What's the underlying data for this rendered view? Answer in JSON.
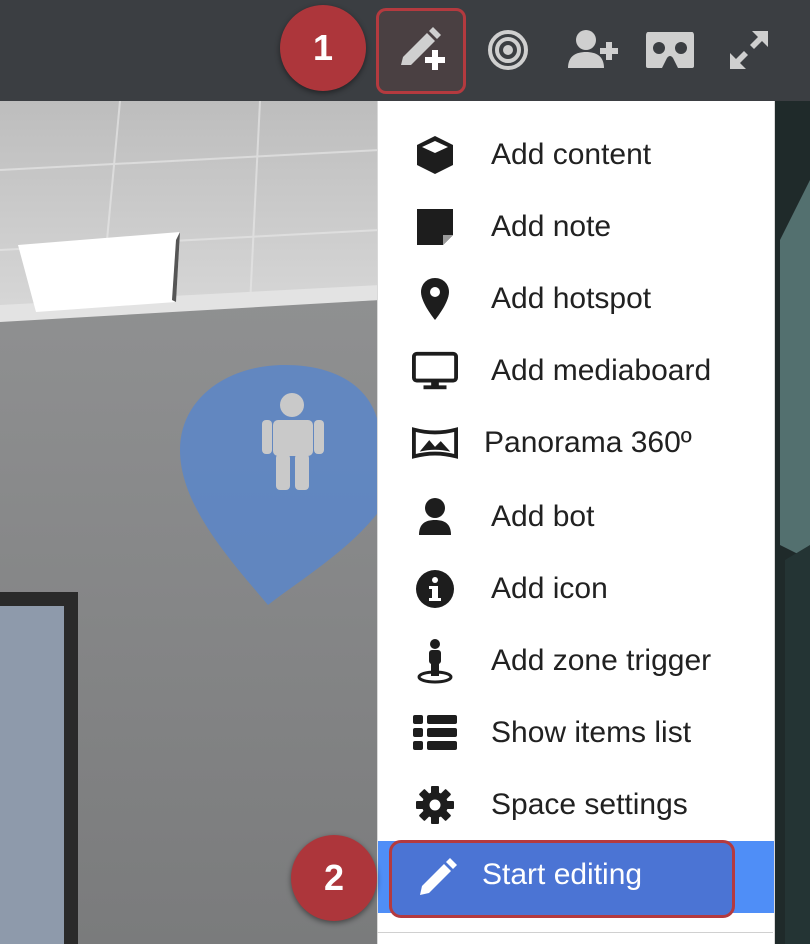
{
  "toolbar": {
    "buttons": [
      {
        "icon": "edit-add-icon",
        "active": true
      },
      {
        "icon": "target-icon"
      },
      {
        "icon": "add-user-icon"
      },
      {
        "icon": "vr-headset-icon"
      },
      {
        "icon": "expand-icon"
      }
    ]
  },
  "callouts": {
    "step1": "1",
    "step2": "2"
  },
  "menu": {
    "items": [
      {
        "label": "Add content",
        "icon": "cube-icon"
      },
      {
        "label": "Add note",
        "icon": "sticky-note-icon"
      },
      {
        "label": "Add hotspot",
        "icon": "map-marker-icon"
      },
      {
        "label": "Add mediaboard",
        "icon": "monitor-icon"
      },
      {
        "label": "Panorama 360º",
        "icon": "panorama-icon"
      },
      {
        "label": "Add bot",
        "icon": "user-icon"
      },
      {
        "label": "Add icon",
        "icon": "info-circle-icon"
      },
      {
        "label": "Add zone trigger",
        "icon": "zone-trigger-icon"
      },
      {
        "label": "Show items list",
        "icon": "list-icon"
      },
      {
        "label": "Space settings",
        "icon": "gear-icon"
      },
      {
        "label": "Start editing",
        "icon": "pencil-icon",
        "active": true
      }
    ]
  },
  "colors": {
    "toolbar_bg": "#3b3e42",
    "highlight": "#b43a3f",
    "menu_active": "#4f8ef7",
    "hotspot": "#5b86c9"
  }
}
